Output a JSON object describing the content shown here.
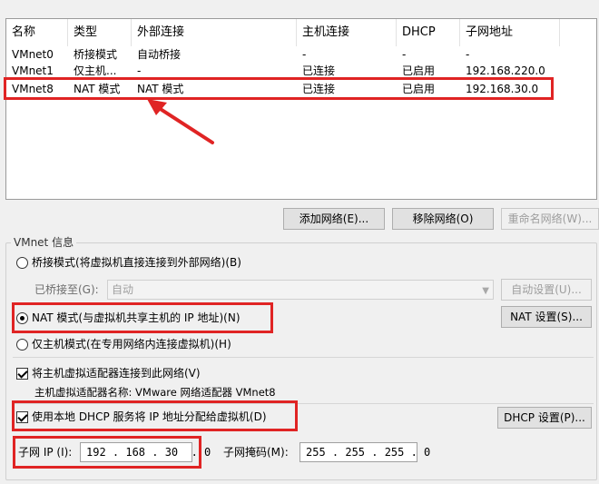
{
  "network_list": {
    "columns": [
      "名称",
      "类型",
      "外部连接",
      "主机连接",
      "DHCP",
      "子网地址"
    ],
    "rows": [
      {
        "name": "VMnet0",
        "type": "桥接模式",
        "external": "自动桥接",
        "host": "-",
        "dhcp": "-",
        "subnet": "-"
      },
      {
        "name": "VMnet1",
        "type": "仅主机...",
        "external": "-",
        "host": "已连接",
        "dhcp": "已启用",
        "subnet": "192.168.220.0"
      },
      {
        "name": "VMnet8",
        "type": "NAT 模式",
        "external": "NAT 模式",
        "host": "已连接",
        "dhcp": "已启用",
        "subnet": "192.168.30.0"
      }
    ],
    "selected_row": 2
  },
  "list_buttons": {
    "add": "添加网络(E)...",
    "remove": "移除网络(O)",
    "rename": "重命名网络(W)..."
  },
  "vmnet_info": {
    "title": "VMnet 信息",
    "bridged_label": "桥接模式(将虚拟机直接连接到外部网络)(B)",
    "bridged_to_label": "已桥接至(G):",
    "bridged_to_value": "自动",
    "auto_settings": "自动设置(U)...",
    "nat_label": "NAT 模式(与虚拟机共享主机的 IP 地址)(N)",
    "nat_settings": "NAT 设置(S)...",
    "hostonly_label": "仅主机模式(在专用网络内连接虚拟机)(H)",
    "selected_mode": "nat",
    "connect_adapter_label": "将主机虚拟适配器连接到此网络(V)",
    "connect_adapter_checked": true,
    "adapter_name_label": "主机虚拟适配器名称: VMware 网络适配器 VMnet8",
    "use_dhcp_label": "使用本地 DHCP 服务将 IP 地址分配给虚拟机(D)",
    "use_dhcp_checked": true,
    "dhcp_settings": "DHCP 设置(P)...",
    "subnet_ip_label": "子网 IP (I):",
    "subnet_ip_value": "192 . 168 . 30  . 0",
    "subnet_mask_label": "子网掩码(M):",
    "subnet_mask_value": "255 . 255 . 255 . 0"
  },
  "colors": {
    "annotation_red": "#e02424",
    "window_bg": "#f0f0f0"
  }
}
